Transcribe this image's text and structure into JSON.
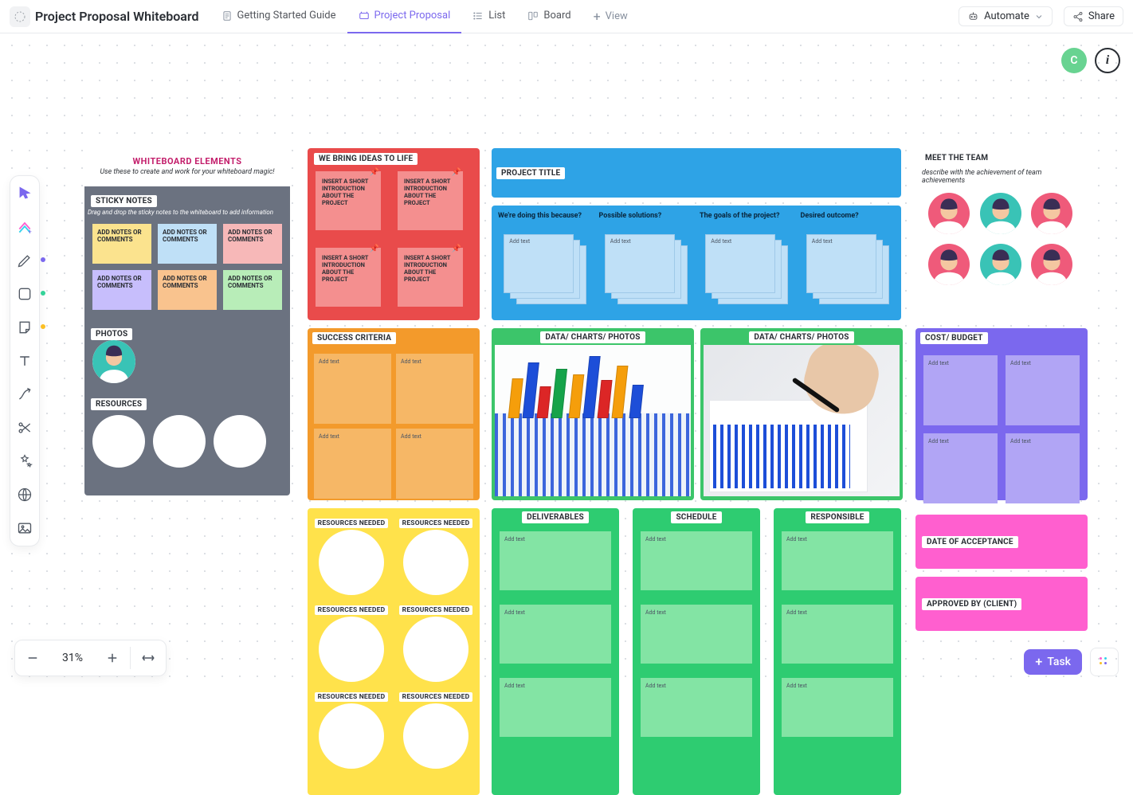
{
  "header": {
    "title": "Project Proposal Whiteboard",
    "tabs": [
      {
        "label": "Getting Started Guide",
        "icon": "doc-icon"
      },
      {
        "label": "Project Proposal",
        "icon": "whiteboard-icon"
      },
      {
        "label": "List",
        "icon": "list-icon"
      },
      {
        "label": "Board",
        "icon": "board-icon"
      }
    ],
    "add_view": "View",
    "automate": "Automate",
    "share": "Share"
  },
  "user_badge": "C",
  "zoom": {
    "percent": "31%"
  },
  "task_button": "Task",
  "elements_card": {
    "title": "WHITEBOARD ELEMENTS",
    "subtitle": "Use these to create and work for your whiteboard magic!",
    "sticky_section": {
      "title": "STICKY NOTES",
      "subtitle": "Drag and drop the sticky notes to the whiteboard to add information",
      "note_text": "ADD NOTES OR COMMENTS"
    },
    "photos_title": "PHOTOS",
    "resources_title": "RESOURCES"
  },
  "panel_ideas": {
    "title": "WE BRING IDEAS TO LIFE",
    "note_text": "INSERT A SHORT INTRODUCTION ABOUT THE PROJECT"
  },
  "panel_project_title": {
    "title": "PROJECT TITLE"
  },
  "panel_blue_cols": {
    "q1": "We're doing this because?",
    "q2": "Possible solutions?",
    "q3": "The goals of the project?",
    "q4": "Desired outcome?",
    "add": "Add text"
  },
  "panel_success": {
    "title": "SUCCESS CRITERIA",
    "add": "Add text"
  },
  "panel_data": {
    "title": "DATA/ CHARTS/ PHOTOS"
  },
  "panel_team": {
    "title": "MEET THE TEAM",
    "subtitle": "describe with the achievement of team achievements"
  },
  "panel_cost": {
    "title": "COST/ BUDGET",
    "add": "Add text"
  },
  "panel_resneeded": {
    "title": "RESOURCES NEEDED"
  },
  "panel_g3": {
    "deliverables": "DELIVERABLES",
    "schedule": "SCHEDULE",
    "responsible": "RESPONSIBLE",
    "add": "Add text"
  },
  "panel_pink": {
    "date": "DATE OF ACCEPTANCE",
    "approved": "APPROVED BY (CLIENT)"
  }
}
